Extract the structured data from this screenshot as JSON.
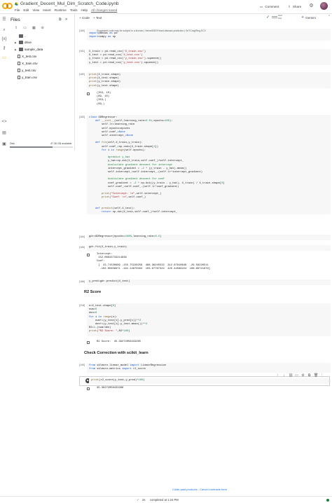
{
  "header": {
    "title": "Gradient_Decent_Mul_Dim_Scratch_Code.ipynb",
    "menu": [
      "File",
      "Edit",
      "View",
      "Insert",
      "Runtime",
      "Tools",
      "Help"
    ],
    "saved_status": "All changes saved",
    "comment_label": "Comment",
    "share_label": "Share"
  },
  "toolbar": {
    "add_code": "+ Code",
    "add_text": "+ Text",
    "ram_label": "RAM",
    "disk_label": "Disk",
    "gemini_label": "Gemini"
  },
  "files": {
    "title": "Files",
    "items": [
      {
        "name": "..",
        "type": "folder",
        "expandable": false
      },
      {
        "name": "drive",
        "type": "folder",
        "expandable": true
      },
      {
        "name": "sample_data",
        "type": "folder",
        "expandable": true
      },
      {
        "name": "X_test.csv",
        "type": "file"
      },
      {
        "name": "X_train.csv",
        "type": "file"
      },
      {
        "name": "y_test.csv",
        "type": "file"
      },
      {
        "name": "y_train.csv",
        "type": "file"
      }
    ],
    "disk_label": "Disk",
    "disk_available": "47.36 GB available",
    "disk_used_fraction": 0.68
  },
  "cells": {
    "c1": {
      "exec": "[180]",
      "warning": "Suggested code may be subject to a license | Hemel5387/Heart-disease-prediction | SeTCrag/Reg-ECV",
      "code": [
        [
          [
            "kw",
            "import"
          ],
          [
            "",
            "pandas "
          ],
          [
            "kw",
            "as"
          ],
          [
            "",
            " pd"
          ]
        ],
        [
          [
            "kw",
            "import"
          ],
          [
            "",
            "numpy "
          ],
          [
            "kw",
            "as"
          ],
          [
            "",
            " np"
          ]
        ]
      ]
    },
    "c2": {
      "exec": "[181]",
      "code": [
        [
          [
            "",
            "X_train = pd.read_csv("
          ],
          [
            "st",
            "'X_train.csv'"
          ],
          [
            "",
            ")"
          ]
        ],
        [
          [
            "",
            "X_test = pd.read_csv("
          ],
          [
            "st",
            "'X_test.csv'"
          ],
          [
            "",
            ")"
          ]
        ],
        [
          [
            "",
            "y_train = pd.read_csv("
          ],
          [
            "st",
            "'y_train.csv'"
          ],
          [
            "",
            ").squeeze()"
          ]
        ],
        [
          [
            "",
            "y_test = pd.read_csv("
          ],
          [
            "st",
            "'y_test.csv'"
          ],
          [
            "",
            ").squeeze()"
          ]
        ]
      ]
    },
    "c3": {
      "exec": "[182]",
      "code": [
        [
          [
            "fn",
            "print"
          ],
          [
            "",
            "(X_train.shape)"
          ]
        ],
        [
          [
            "fn",
            "print"
          ],
          [
            "",
            "(X_test.shape)"
          ]
        ],
        [
          [
            "fn",
            "print"
          ],
          [
            "",
            "(y_train.shape)"
          ]
        ],
        [
          [
            "fn",
            "print"
          ],
          [
            "",
            "(y_test.shape)"
          ]
        ]
      ],
      "output": [
        "(353, 10)",
        "(89, 10)",
        "(353,)",
        "(89,)"
      ]
    },
    "c4": {
      "exec": "[183]",
      "code": [
        [
          [
            "kw",
            "class"
          ],
          [
            "",
            " GDRegressor:"
          ]
        ],
        [
          [
            "",
            "    "
          ],
          [
            "kw",
            "def"
          ],
          [
            "",
            " "
          ],
          [
            "fn",
            "__init__"
          ],
          [
            "",
            "(self,learning_rate="
          ],
          [
            "nu",
            "0.01"
          ],
          [
            "",
            ",epochs="
          ],
          [
            "nu",
            "100"
          ],
          [
            "",
            "):"
          ]
        ],
        [
          [
            "",
            "        self.lr=learning_rate"
          ]
        ],
        [
          [
            "",
            "        self.epochs=epochs"
          ]
        ],
        [
          [
            "",
            "        self.coef_="
          ],
          [
            "kw",
            "None"
          ]
        ],
        [
          [
            "",
            "        self.intercept_="
          ],
          [
            "kw",
            "None"
          ]
        ],
        [
          [
            "",
            ""
          ]
        ],
        [
          [
            "",
            "    "
          ],
          [
            "kw",
            "def"
          ],
          [
            "",
            " "
          ],
          [
            "fn",
            "fit"
          ],
          [
            "",
            "(self,X_train,y_train):"
          ]
        ],
        [
          [
            "",
            "        self.coef_=np.ones(X_train.shape["
          ],
          [
            "nu",
            "1"
          ],
          [
            "",
            "])"
          ]
        ],
        [
          [
            "",
            "        "
          ],
          [
            "kw",
            "for"
          ],
          [
            "",
            " i "
          ],
          [
            "kw",
            "in"
          ],
          [
            "",
            " "
          ],
          [
            "fn",
            "range"
          ],
          [
            "",
            "(self.epochs):"
          ]
        ],
        [
          [
            "",
            ""
          ]
        ],
        [
          [
            "",
            "            "
          ],
          [
            "cm",
            "#predict y_hat"
          ]
        ],
        [
          [
            "",
            "            y_hat=np.dot(X_train,self.coef_)+self.intercept_"
          ]
        ],
        [
          [
            "",
            "            "
          ],
          [
            "cm",
            "#calculate gradient descent for intercept"
          ]
        ],
        [
          [
            "",
            "            intercept_gradient = -"
          ],
          [
            "nu",
            "2"
          ],
          [
            "",
            " * (y_train - y_hat).mean()"
          ]
        ],
        [
          [
            "",
            "            self.intercept_=self.intercept_-(self.lr*intercept_gradient)"
          ]
        ],
        [
          [
            "",
            ""
          ]
        ],
        [
          [
            "",
            "            "
          ],
          [
            "cm",
            "#calculate gradient descent for coef"
          ]
        ],
        [
          [
            "",
            "            coef_gradient = -"
          ],
          [
            "nu",
            "2"
          ],
          [
            "",
            " * np.dot((y_train - y_hat), X_train) / X_train.shape["
          ],
          [
            "nu",
            "0"
          ],
          [
            "",
            "]"
          ]
        ],
        [
          [
            "",
            "            self.coef_=self.coef_-(self.lr*coef_gradient)"
          ]
        ],
        [
          [
            "",
            ""
          ]
        ],
        [
          [
            "",
            "        "
          ],
          [
            "fn",
            "print"
          ],
          [
            "",
            "("
          ],
          [
            "st",
            "\"Intercept: \\n\""
          ],
          [
            "",
            ",self.intercept_)"
          ]
        ],
        [
          [
            "",
            "        "
          ],
          [
            "fn",
            "print"
          ],
          [
            "",
            "("
          ],
          [
            "st",
            "\"Coef: \\n\""
          ],
          [
            "",
            ",self.coef_)"
          ]
        ],
        [
          [
            "",
            ""
          ]
        ],
        [
          [
            "",
            ""
          ]
        ],
        [
          [
            "",
            "    "
          ],
          [
            "kw",
            "def"
          ],
          [
            "",
            " "
          ],
          [
            "fn",
            "predict"
          ],
          [
            "",
            "(self,X_test):"
          ]
        ],
        [
          [
            "",
            "        "
          ],
          [
            "kw",
            "return"
          ],
          [
            "",
            " np.dot(X_test,self.coef_)+self.intercept_"
          ]
        ]
      ]
    },
    "c5": {
      "exec": "[184]",
      "code": [
        [
          [
            "",
            "gdr=GDRegressor(epochs="
          ],
          [
            "nu",
            "1000"
          ],
          [
            "",
            ",learning_rate="
          ],
          [
            "nu",
            "0.5"
          ],
          [
            "",
            ")"
          ]
        ]
      ]
    },
    "c6": {
      "exec": "[185]",
      "code": [
        [
          [
            "",
            "gdr.fit(X_train,y_train)"
          ]
        ]
      ],
      "output": [
        "Intercept:",
        " 152.06633733214936",
        "Coef:",
        " [  23.71530989 -155.75228259  468.36245532  312.67810649  -29.58226511",
        "  -102.00406871 -191.14670404  103.87767324  425.44598224  108.89721979]"
      ]
    },
    "c7": {
      "exec": "[186]",
      "code": [
        [
          [
            "",
            "y_pred=gdr.predict(X_test)"
          ]
        ]
      ]
    },
    "md1": {
      "title": "R2 Score"
    },
    "c8": {
      "exec": "[218]",
      "code": [
        [
          [
            "",
            "n=X_test.shape["
          ],
          [
            "nu",
            "0"
          ],
          [
            "",
            "]"
          ]
        ],
        [
          [
            "",
            "num="
          ],
          [
            "nu",
            "0"
          ]
        ],
        [
          [
            "",
            "den="
          ],
          [
            "nu",
            "0"
          ]
        ],
        [
          [
            "kw",
            "for"
          ],
          [
            "",
            " i "
          ],
          [
            "kw",
            "in"
          ],
          [
            "",
            " "
          ],
          [
            "fn",
            "range"
          ],
          [
            "",
            "(n):"
          ]
        ],
        [
          [
            "",
            "    num+=(y_test[i]-y_pred[i])**"
          ],
          [
            "nu",
            "2"
          ]
        ],
        [
          [
            "",
            "    den+=(y_test[i]-y_test.mean())**"
          ],
          [
            "nu",
            "2"
          ]
        ],
        [
          [
            "",
            "R2="
          ],
          [
            "nu",
            "1"
          ],
          [
            "",
            "-(num/den)"
          ]
        ],
        [
          [
            "fn",
            "print"
          ],
          [
            "",
            "("
          ],
          [
            "st",
            "\"R2 Score: \""
          ],
          [
            "",
            ",R2*"
          ],
          [
            "nu",
            "100"
          ],
          [
            "",
            ")"
          ]
        ]
      ],
      "output": [
        "R2 Score:  45.39272058433265"
      ]
    },
    "md2": {
      "title": "Check Correction with scikit_learn"
    },
    "c9": {
      "exec": "[190]",
      "code": [
        [
          [
            "kw",
            "from"
          ],
          [
            "",
            " sklearn.linear_model "
          ],
          [
            "kw",
            "import"
          ],
          [
            "",
            " LinearRegression"
          ]
        ],
        [
          [
            "kw",
            "from"
          ],
          [
            "",
            " sklearn.metrics "
          ],
          [
            "kw",
            "import"
          ],
          [
            "",
            " r2_score"
          ]
        ]
      ]
    },
    "c10": {
      "code": [
        [
          [
            "fn",
            "print"
          ],
          [
            "",
            "(r2_score(y_test,y_pred)*"
          ],
          [
            "nu",
            "100"
          ],
          [
            "",
            ")"
          ]
        ]
      ],
      "output": [
        "45.39272058433266"
      ]
    }
  },
  "footer": {
    "links": "Colab paid products - Cancel contracts here",
    "status_check": "✓",
    "status_time": "2s",
    "status_text": "completed at 1:24 PM"
  },
  "colors": {
    "accent": "#1a73e8",
    "success": "#188038",
    "logo_primary": "#f9ab00",
    "logo_secondary": "#e8710a"
  }
}
